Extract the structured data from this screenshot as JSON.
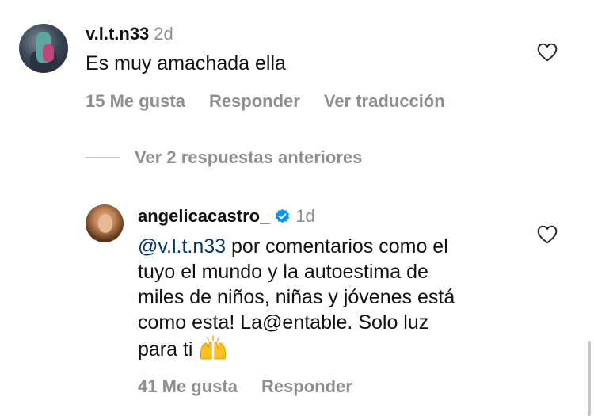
{
  "comments": [
    {
      "username": "v.l.t.n33",
      "time": "2d",
      "text": "Es muy amachada ella",
      "likes": "15 Me gusta",
      "reply": "Responder",
      "translate": "Ver traducción"
    },
    {
      "username": "angelicacastro_",
      "time": "1d",
      "mention": "@v.l.t.n33",
      "text_lines": [
        " por comentarios como el",
        "tuyo el mundo y la autoestima de",
        "miles de niños, niñas y jóvenes está",
        "como esta! La@entable. Solo luz",
        "para ti"
      ],
      "likes": "41 Me gusta",
      "reply": "Responder"
    }
  ],
  "view_replies": "Ver 2 respuestas anteriores",
  "icons": {
    "heart": "heart-outline-icon",
    "verified": "verified-badge-icon",
    "emoji": "raising-hands-emoji"
  },
  "colors": {
    "mention": "#00376b",
    "secondary_text": "#8e8e8e",
    "verified_blue": "#0095f6"
  }
}
